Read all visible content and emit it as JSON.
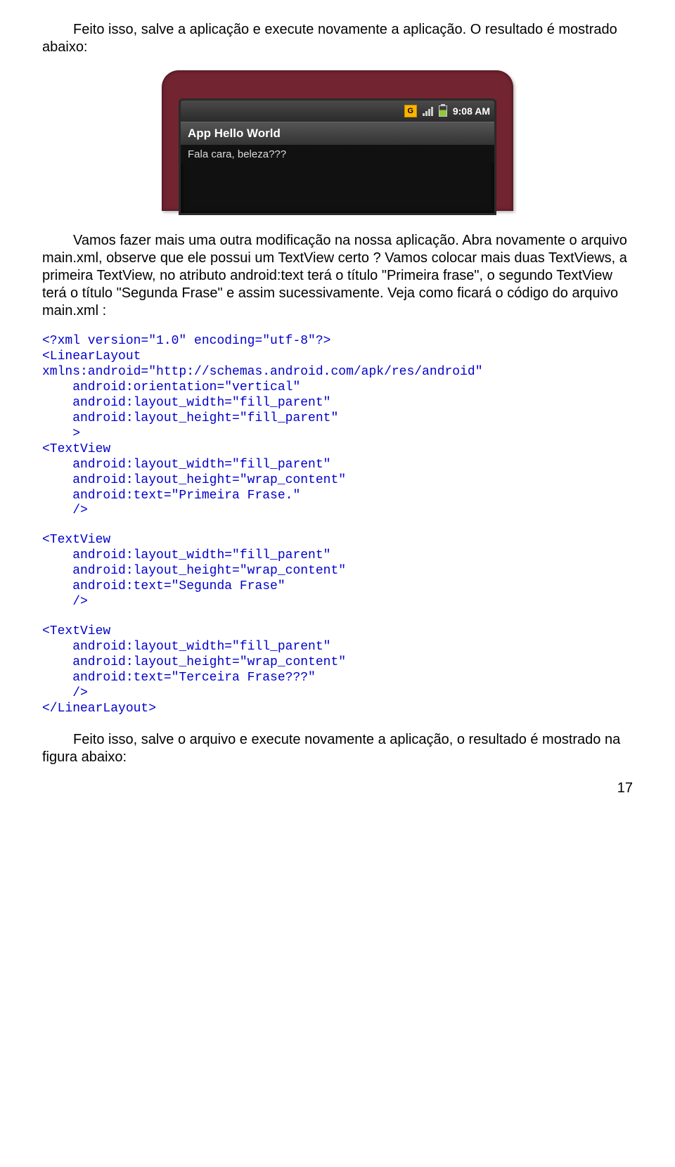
{
  "para1": "Feito isso, salve a aplicação e execute novamente a aplicação. O resultado é mostrado abaixo:",
  "device": {
    "g_icon": "G",
    "time": "9:08 AM",
    "title": "App Hello World",
    "content": "Fala cara, beleza???"
  },
  "para2": "Vamos fazer mais uma outra modificação na nossa aplicação. Abra novamente o arquivo main.xml, observe que ele possui um TextView certo ? Vamos colocar mais duas TextViews, a primeira TextView, no atributo android:text terá o título \"Primeira frase\", o segundo TextView terá o título \"Segunda Frase\" e assim sucessivamente. Veja como ficará o código do arquivo main.xml :",
  "code1": "<?xml version=\"1.0\" encoding=\"utf-8\"?>\n<LinearLayout\nxmlns:android=\"http://schemas.android.com/apk/res/android\"\n    android:orientation=\"vertical\"\n    android:layout_width=\"fill_parent\"\n    android:layout_height=\"fill_parent\"\n    >\n<TextView\n    android:layout_width=\"fill_parent\"\n    android:layout_height=\"wrap_content\"\n    android:text=\"Primeira Frase.\"\n    />",
  "code2": "<TextView\n    android:layout_width=\"fill_parent\"\n    android:layout_height=\"wrap_content\"\n    android:text=\"Segunda Frase\"\n    />",
  "code3": "<TextView\n    android:layout_width=\"fill_parent\"\n    android:layout_height=\"wrap_content\"\n    android:text=\"Terceira Frase???\"\n    />\n</LinearLayout>",
  "para3": "Feito isso, salve o arquivo e execute novamente a aplicação, o resultado é mostrado na figura abaixo:",
  "pagenum": "17"
}
